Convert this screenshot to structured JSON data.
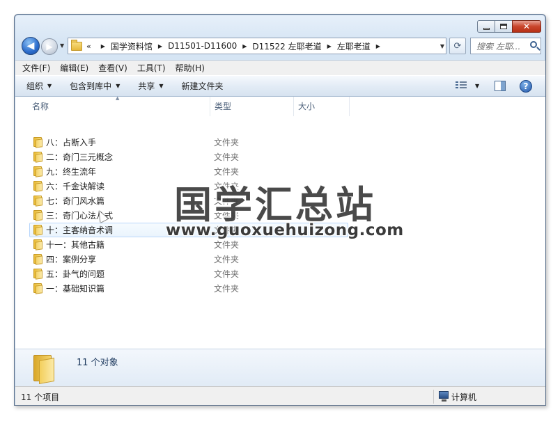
{
  "window": {
    "caption": {
      "minimize": "—",
      "maximize": "□",
      "close": "✕"
    }
  },
  "nav": {
    "back_glyph": "◀",
    "forward_glyph": "▶",
    "history_glyph": "▼",
    "overflow": "«",
    "breadcrumbs": [
      "国学资料馆",
      "D11501-D11600",
      "D11522 左耶老道",
      "左耶老道"
    ],
    "crumb_sep": "▶",
    "dropdown_glyph": "▼",
    "refresh_glyph": "⟳",
    "search_placeholder": "搜索 左耶..."
  },
  "menubar": {
    "items": [
      "文件(F)",
      "编辑(E)",
      "查看(V)",
      "工具(T)",
      "帮助(H)"
    ]
  },
  "toolbar": {
    "commands": [
      "组织",
      "包含到库中",
      "共享",
      "新建文件夹"
    ],
    "caret": "▼",
    "help": "?"
  },
  "columns": {
    "name": "名称",
    "type": "类型",
    "size": "大小"
  },
  "files": [
    {
      "name": "八：占断入手",
      "type": "文件夹"
    },
    {
      "name": "二：奇门三元概念",
      "type": "文件夹"
    },
    {
      "name": "九：终生流年",
      "type": "文件夹"
    },
    {
      "name": "六：千金诀解读",
      "type": "文件夹"
    },
    {
      "name": "七：奇门风水篇",
      "type": "文件夹"
    },
    {
      "name": "三：奇门心法八式",
      "type": "文件夹"
    },
    {
      "name": "十：主客纳音术调",
      "type": "文件夹"
    },
    {
      "name": "十一：其他古籍",
      "type": "文件夹"
    },
    {
      "name": "四：案例分享",
      "type": "文件夹"
    },
    {
      "name": "五：卦气的问题",
      "type": "文件夹"
    },
    {
      "name": "一：基础知识篇",
      "type": "文件夹"
    }
  ],
  "watermark": {
    "title": "国学汇总站",
    "url": "www.guoxuehuizong.com"
  },
  "details": {
    "count": "11 个对象"
  },
  "status": {
    "items": "11 个项目",
    "location": "计算机"
  }
}
